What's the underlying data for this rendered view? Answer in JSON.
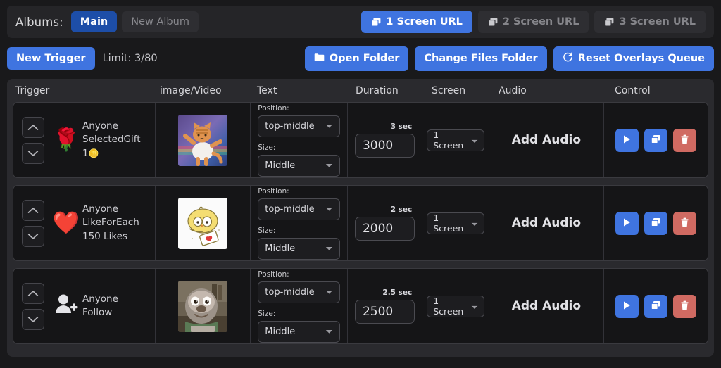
{
  "album_bar": {
    "label": "Albums:",
    "albums": [
      {
        "name": "Main",
        "active": true
      },
      {
        "name": "New Album",
        "active": false
      }
    ],
    "screen_urls": [
      {
        "label": "1 Screen URL",
        "icon": "copy-icon",
        "active": true
      },
      {
        "label": "2 Screen URL",
        "icon": "copy-icon",
        "active": false
      },
      {
        "label": "3 Screen URL",
        "icon": "copy-icon",
        "active": false
      }
    ]
  },
  "toolbar": {
    "new_trigger_label": "New Trigger",
    "limit_text": "Limit: 3/80",
    "open_folder_label": "Open Folder",
    "change_files_folder_label": "Change Files Folder",
    "reset_queue_label": "Reset Overlays Queue"
  },
  "table": {
    "headers": {
      "trigger": "Trigger",
      "media": "image/Video",
      "text": "Text",
      "duration": "Duration",
      "screen": "Screen",
      "audio": "Audio",
      "control": "Control"
    },
    "field_labels": {
      "position": "Position:",
      "size": "Size:"
    },
    "audio_label": "Add Audio",
    "rows": [
      {
        "trigger": {
          "emoji": "🌹",
          "icon_name": "rose-gift-icon",
          "line1": "Anyone",
          "line2": "SelectedGift",
          "line3": "1",
          "coin": "🪙"
        },
        "media": {
          "icon_name": "dancing-cat-thumbnail",
          "alt": "dancing orange cat"
        },
        "position_value": "top-middle",
        "size_value": "Middle",
        "duration_seconds": "3 sec",
        "duration_ms": "3000",
        "screen_value": "1 Screen"
      },
      {
        "trigger": {
          "emoji": "❤️",
          "icon_name": "heart-icon",
          "line1": "Anyone",
          "line2": "LikeForEach",
          "line3": "150 Likes",
          "coin": ""
        },
        "media": {
          "icon_name": "yellow-chick-thumbnail",
          "alt": "yellow chick sticker"
        },
        "position_value": "top-middle",
        "size_value": "Middle",
        "duration_seconds": "2 sec",
        "duration_ms": "2000",
        "screen_value": "1 Screen"
      },
      {
        "trigger": {
          "emoji": "",
          "icon_name": "person-add-icon",
          "line1": "Anyone",
          "line2": "Follow",
          "line3": "",
          "coin": ""
        },
        "media": {
          "icon_name": "sloth-thumbnail",
          "alt": "sloth character"
        },
        "position_value": "top-middle",
        "size_value": "Middle",
        "duration_seconds": "2.5 sec",
        "duration_ms": "2500",
        "screen_value": "1 Screen"
      }
    ],
    "control_buttons": [
      {
        "name": "play-button",
        "icon": "play-icon"
      },
      {
        "name": "duplicate-button",
        "icon": "copy-icon"
      },
      {
        "name": "delete-button",
        "icon": "trash-icon"
      }
    ]
  },
  "colors": {
    "accent_blue": "#3f74e0",
    "active_album_blue": "#1d4ea8",
    "delete_red": "#d06a62",
    "app_bg": "#19191b",
    "panel_bg": "#2a2a2e",
    "row_bg": "#151517"
  }
}
